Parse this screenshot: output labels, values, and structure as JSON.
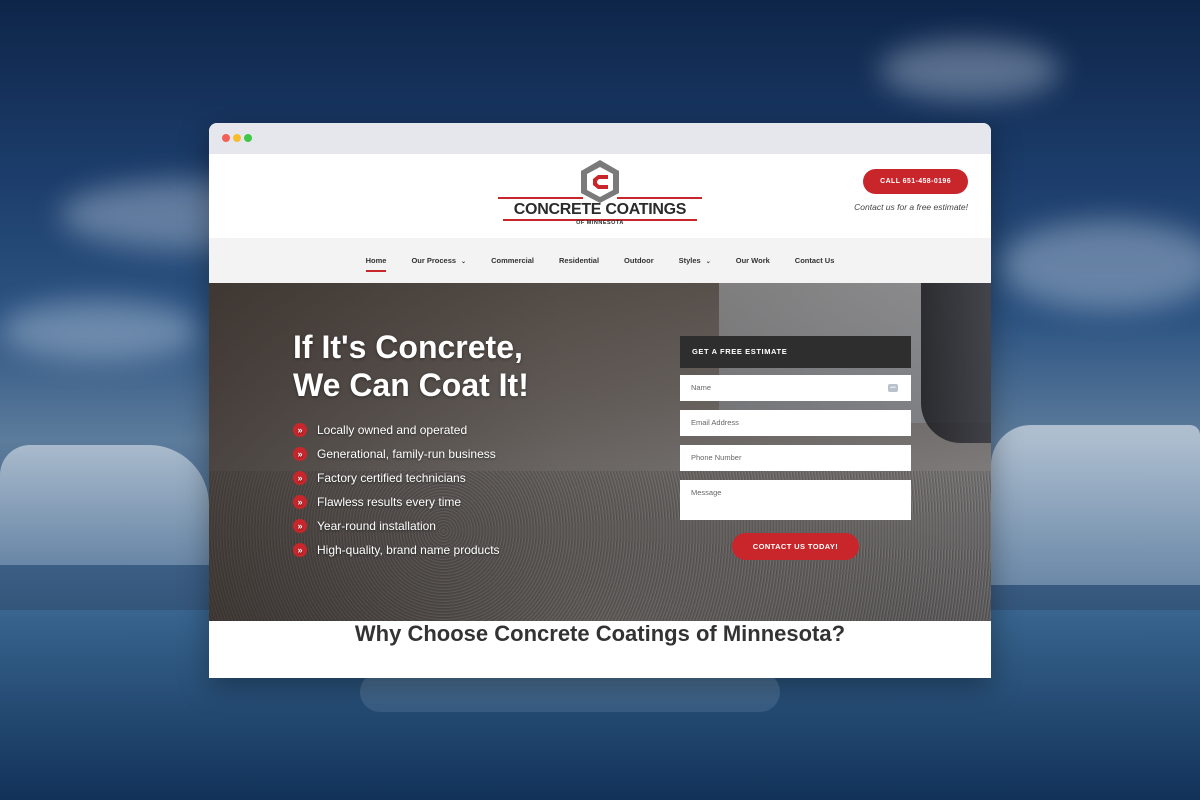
{
  "window": {
    "controls": [
      "close",
      "minimize",
      "maximize"
    ]
  },
  "header": {
    "logo": {
      "name": "CONCRETE COATINGS",
      "sub": "OF MINNESOTA",
      "icon": "c-hexagon-logo"
    },
    "call_button": "CALL 651-458-0196",
    "call_note": "Contact us for a free estimate!"
  },
  "nav": {
    "items": [
      {
        "label": "Home",
        "active": true
      },
      {
        "label": "Our Process",
        "dropdown": true
      },
      {
        "label": "Commercial"
      },
      {
        "label": "Residential"
      },
      {
        "label": "Outdoor"
      },
      {
        "label": "Styles",
        "dropdown": true
      },
      {
        "label": "Our Work"
      },
      {
        "label": "Contact Us"
      }
    ]
  },
  "hero": {
    "headline_line1": "If It's Concrete,",
    "headline_line2": "We Can Coat It!",
    "features": [
      "Locally owned and operated",
      "Generational, family-run business",
      "Factory certified technicians",
      "Flawless results every time",
      "Year-round installation",
      "High-quality, brand name products"
    ]
  },
  "form": {
    "title": "GET A FREE ESTIMATE",
    "name_placeholder": "Name",
    "email_placeholder": "Email Address",
    "phone_placeholder": "Phone Number",
    "message_placeholder": "Message",
    "submit": "CONTACT US TODAY!"
  },
  "section": {
    "title": "Why Choose Concrete Coatings of Minnesota?"
  },
  "colors": {
    "accent": "#c8262b",
    "dark": "#2e2e2e"
  }
}
